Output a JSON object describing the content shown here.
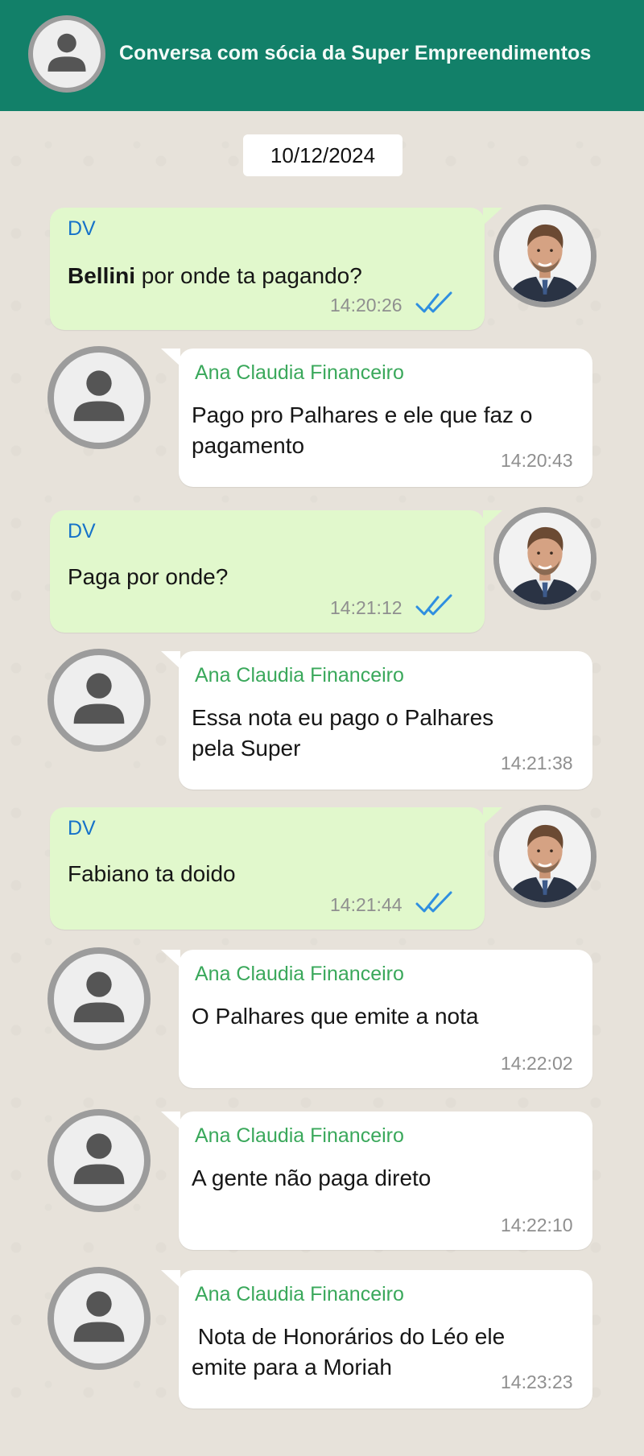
{
  "header": {
    "title": "Conversa com sócia da Super Empreendimentos",
    "avatar_icon": "person-icon"
  },
  "date": "10/12/2024",
  "contacts": {
    "me": "DV",
    "other": "Ana Claudia Financeiro"
  },
  "colors": {
    "header_green": "#128069",
    "sent_bubble": "#e1f8cc",
    "received_bubble": "#ffffff",
    "sender_me": "#1672c9",
    "sender_other": "#3aa85b",
    "read_ticks": "#2f8fe0",
    "background": "#e6e1d9"
  },
  "messages": [
    {
      "direction": "sent",
      "sender": "DV",
      "text_bold": "Bellini",
      "text": " por onde ta pagando?",
      "time": "14:20:26",
      "status": "read"
    },
    {
      "direction": "received",
      "sender": "Ana Claudia Financeiro",
      "text_lines": [
        "Pago pro Palhares e ele que faz o",
        "pagamento"
      ],
      "time": "14:20:43"
    },
    {
      "direction": "sent",
      "sender": "DV",
      "text": "Paga por onde?",
      "time": "14:21:12",
      "status": "read"
    },
    {
      "direction": "received",
      "sender": "Ana Claudia Financeiro",
      "text_lines": [
        "Essa nota eu pago o Palhares",
        "pela Super"
      ],
      "time": "14:21:38"
    },
    {
      "direction": "sent",
      "sender": "DV",
      "text": "Fabiano ta doido",
      "time": "14:21:44",
      "status": "read"
    },
    {
      "direction": "received",
      "sender": "Ana Claudia Financeiro",
      "text": "O Palhares que emite a nota",
      "time": "14:22:02"
    },
    {
      "direction": "received",
      "sender": "Ana Claudia Financeiro",
      "text": "A gente não paga direto",
      "time": "14:22:10"
    },
    {
      "direction": "received",
      "sender": "Ana Claudia Financeiro",
      "text_lines": [
        " Nota de Honorários do Léo ele",
        "emite para a Moriah"
      ],
      "time": "14:23:23"
    }
  ]
}
